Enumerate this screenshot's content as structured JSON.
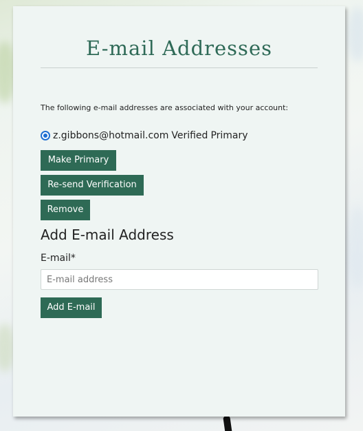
{
  "page": {
    "title": "E-mail Addresses",
    "intro": "The following e-mail addresses are associated with your account:"
  },
  "emails": [
    {
      "address": "z.gibbons@hotmail.com",
      "verified_label": "Verified",
      "primary_label": "Primary",
      "selected": true
    }
  ],
  "actions": {
    "make_primary": "Make Primary",
    "resend_verification": "Re-send Verification",
    "remove": "Remove"
  },
  "add_section": {
    "heading": "Add E-mail Address",
    "field_label": "E-mail*",
    "placeholder": "E-mail address",
    "value": "",
    "submit_label": "Add E-mail"
  },
  "colors": {
    "accent": "#2e6a55",
    "title": "#2f6a57",
    "radio": "#1f6fd1",
    "card_background": "#eff5f3"
  }
}
